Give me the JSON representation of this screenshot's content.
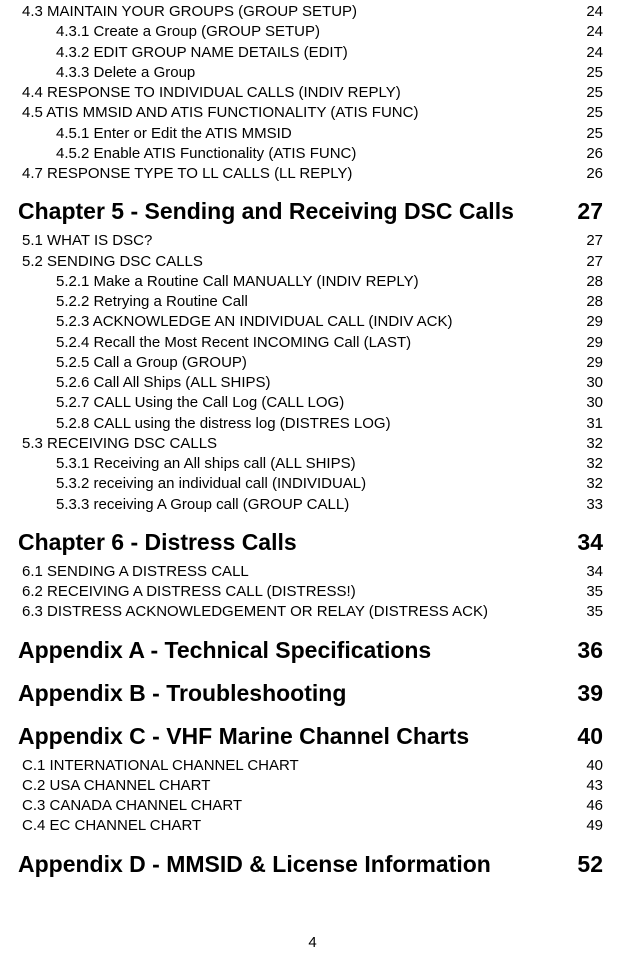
{
  "toc": [
    {
      "level": 2,
      "title": "4.3 MAINTAIN YOUR GROUPS (GROUP SETUP)",
      "page": "24"
    },
    {
      "level": 3,
      "title": "4.3.1 Create a Group (GROUP SETUP)",
      "page": "24"
    },
    {
      "level": 3,
      "title": "4.3.2 EDIT GROUP NAME DETAILS (EDIT)",
      "page": "24"
    },
    {
      "level": 3,
      "title": "4.3.3 Delete a Group",
      "page": "25"
    },
    {
      "level": 2,
      "title": "4.4 RESPONSE TO INDIVIDUAL CALLS (INDIV REPLY)",
      "page": "25"
    },
    {
      "level": 2,
      "title": "4.5 ATIS MMSID AND ATIS FUNCTIONALITY (ATIS FUNC)",
      "page": "25"
    },
    {
      "level": 3,
      "title": "4.5.1 Enter or Edit the ATIS MMSID",
      "page": "25"
    },
    {
      "level": 3,
      "title": "4.5.2 Enable ATIS Functionality (ATIS FUNC)",
      "page": "26"
    },
    {
      "level": 2,
      "title": "4.7 RESPONSE TYPE TO LL CALLS (LL REPLY)",
      "page": "26"
    },
    {
      "level": 1,
      "title": "Chapter 5 - Sending and Receiving DSC Calls",
      "page": "27"
    },
    {
      "level": 2,
      "title": "5.1 WHAT IS DSC?",
      "page": "27"
    },
    {
      "level": 2,
      "title": "5.2 SENDING DSC CALLS",
      "page": "27"
    },
    {
      "level": 3,
      "title": "5.2.1 Make a Routine Call MANUALLY (INDIV REPLY)",
      "page": "28"
    },
    {
      "level": 3,
      "title": "5.2.2 Retrying a Routine Call",
      "page": "28"
    },
    {
      "level": 3,
      "title": "5.2.3 ACKNOWLEDGE AN INDIVIDUAL CALL (INDIV ACK)",
      "page": "29"
    },
    {
      "level": 3,
      "title": "5.2.4 Recall the Most Recent INCOMING Call (LAST)",
      "page": "29"
    },
    {
      "level": 3,
      "title": "5.2.5 Call a Group (GROUP)",
      "page": "29"
    },
    {
      "level": 3,
      "title": "5.2.6 Call All Ships (ALL SHIPS)",
      "page": "30"
    },
    {
      "level": 3,
      "title": "5.2.7 CALL Using the Call Log (CALL LOG)",
      "page": "30"
    },
    {
      "level": 3,
      "title": "5.2.8 CALL using the distress log (DISTRES LOG)",
      "page": "31"
    },
    {
      "level": 2,
      "title": "5.3 RECEIVING DSC CALLS",
      "page": "32"
    },
    {
      "level": 3,
      "title": "5.3.1 Receiving an All ships call (ALL SHIPS)",
      "page": "32"
    },
    {
      "level": 3,
      "title": "5.3.2 receiving an individual call (INDIVIDUAL)",
      "page": "32"
    },
    {
      "level": 3,
      "title": "5.3.3 receiving A Group call (GROUP CALL)",
      "page": "33"
    },
    {
      "level": 1,
      "title": "Chapter 6 - Distress Calls",
      "page": "34"
    },
    {
      "level": 2,
      "title": "6.1 SENDING A DISTRESS CALL",
      "page": "34"
    },
    {
      "level": 2,
      "title": "6.2 RECEIVING A DISTRESS CALL (DISTRESS!)",
      "page": "35"
    },
    {
      "level": 2,
      "title": "6.3 DISTRESS ACKNOWLEDGEMENT OR RELAY (DISTRESS ACK)",
      "page": "35"
    },
    {
      "level": 1,
      "title": "Appendix A - Technical Specifications",
      "page": "36"
    },
    {
      "level": 1,
      "title": "Appendix B - Troubleshooting",
      "page": "39"
    },
    {
      "level": 1,
      "title": "Appendix C - VHF Marine Channel Charts",
      "page": "40"
    },
    {
      "level": 2,
      "title": "C.1 INTERNATIONAL CHANNEL CHART",
      "page": "40"
    },
    {
      "level": 2,
      "title": "C.2 USA CHANNEL CHART",
      "page": "43"
    },
    {
      "level": 2,
      "title": "C.3 CANADA CHANNEL CHART",
      "page": "46"
    },
    {
      "level": 2,
      "title": "C.4 EC CHANNEL CHART",
      "page": "49"
    },
    {
      "level": 1,
      "title": "Appendix D - MMSID & License Information",
      "page": "52"
    }
  ],
  "page_number": "4"
}
